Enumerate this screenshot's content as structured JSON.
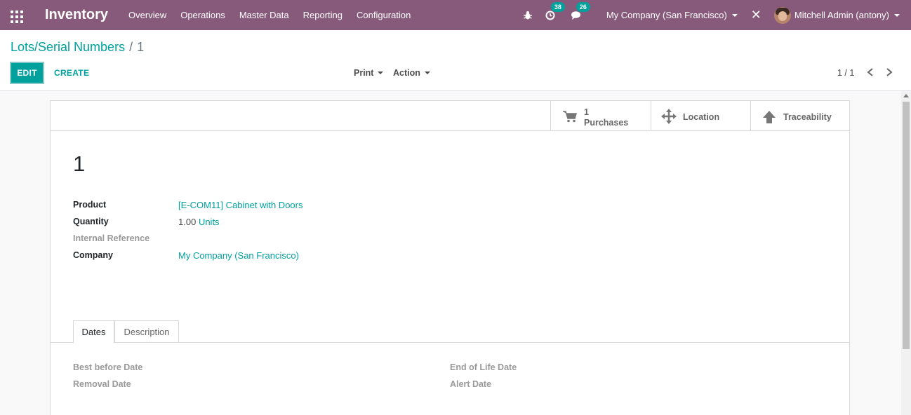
{
  "navbar": {
    "app_name": "Inventory",
    "menu": [
      "Overview",
      "Operations",
      "Master Data",
      "Reporting",
      "Configuration"
    ],
    "activity_count": "38",
    "message_count": "26",
    "company": "My Company (San Francisco)",
    "user": "Mitchell Admin (antony)"
  },
  "breadcrumb": {
    "parent": "Lots/Serial Numbers",
    "separator": "/",
    "current": "1"
  },
  "toolbar": {
    "edit_label": "EDIT",
    "create_label": "CREATE",
    "print_label": "Print",
    "action_label": "Action",
    "pager": "1 / 1"
  },
  "smart_buttons": {
    "purchases_count": "1",
    "purchases_label": "Purchases",
    "location_label": "Location",
    "traceability_label": "Traceability"
  },
  "record": {
    "title": "1",
    "product_label": "Product",
    "product_value": "[E-COM11] Cabinet with Doors",
    "quantity_label": "Quantity",
    "quantity_value": "1.00",
    "quantity_uom": "Units",
    "internal_ref_label": "Internal Reference",
    "company_label": "Company",
    "company_value": "My Company (San Francisco)"
  },
  "tabs": {
    "dates": "Dates",
    "description": "Description"
  },
  "dates": {
    "best_before": "Best before Date",
    "removal": "Removal Date",
    "end_of_life": "End of Life Date",
    "alert": "Alert Date"
  },
  "colors": {
    "navbar": "#875a7b",
    "accent": "#00a09d"
  }
}
